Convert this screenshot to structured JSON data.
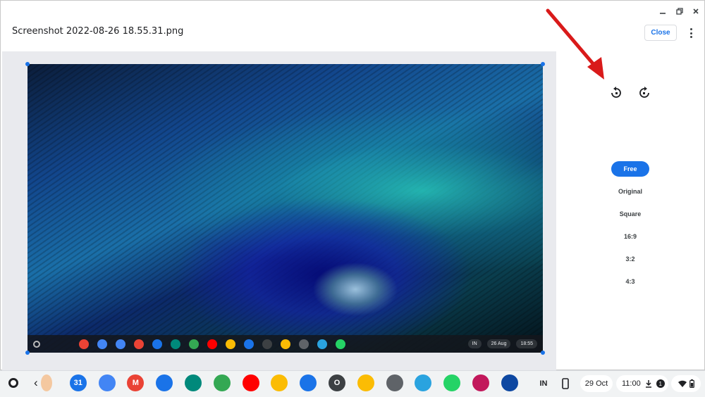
{
  "window": {
    "filename": "Screenshot 2022-08-26 18.55.31.png",
    "close_label": "Close"
  },
  "controls": {
    "minimize_icon": "minimize-icon",
    "restore_icon": "restore-icon",
    "close_icon": "close-icon",
    "rotate_left_icon": "rotate-left-icon",
    "rotate_right_icon": "rotate-right-icon"
  },
  "aspect_ratios": [
    {
      "label": "Free",
      "selected": true
    },
    {
      "label": "Original",
      "selected": false
    },
    {
      "label": "Square",
      "selected": false
    },
    {
      "label": "16:9",
      "selected": false
    },
    {
      "label": "3:2",
      "selected": false
    },
    {
      "label": "4:3",
      "selected": false
    }
  ],
  "image_content": {
    "mini_shelf": {
      "date": "26 Aug",
      "time": "18:55",
      "ime": "IN"
    }
  },
  "shelf": {
    "apps": [
      {
        "name": "app-partial",
        "color": "#f4c8a0"
      },
      {
        "name": "calendar",
        "label": "31",
        "color": "#1a73e8"
      },
      {
        "name": "docs",
        "color": "#4285f4"
      },
      {
        "name": "gmail",
        "label": "M",
        "color": "#ea4335"
      },
      {
        "name": "files",
        "color": "#1a73e8"
      },
      {
        "name": "meet",
        "color": "#00897b"
      },
      {
        "name": "play-store",
        "color": "#34a853"
      },
      {
        "name": "youtube",
        "color": "#ff0000"
      },
      {
        "name": "photos",
        "color": "#fbbc04"
      },
      {
        "name": "messages",
        "color": "#1a73e8"
      },
      {
        "name": "o-app",
        "label": "O",
        "color": "#3c4043"
      },
      {
        "name": "keep",
        "color": "#fbbc04"
      },
      {
        "name": "settings",
        "color": "#5f6368"
      },
      {
        "name": "telegram",
        "color": "#2aa3df"
      },
      {
        "name": "whatsapp",
        "color": "#25d366"
      },
      {
        "name": "screenshot-app",
        "color": "#c2185b"
      },
      {
        "name": "gallery",
        "color": "#0d47a1"
      }
    ],
    "ime": "IN",
    "date": "29 Oct",
    "time": "11:00",
    "notification_count": "1"
  },
  "colors": {
    "accent": "#1a73e8",
    "arrow": "#d91a1a"
  }
}
